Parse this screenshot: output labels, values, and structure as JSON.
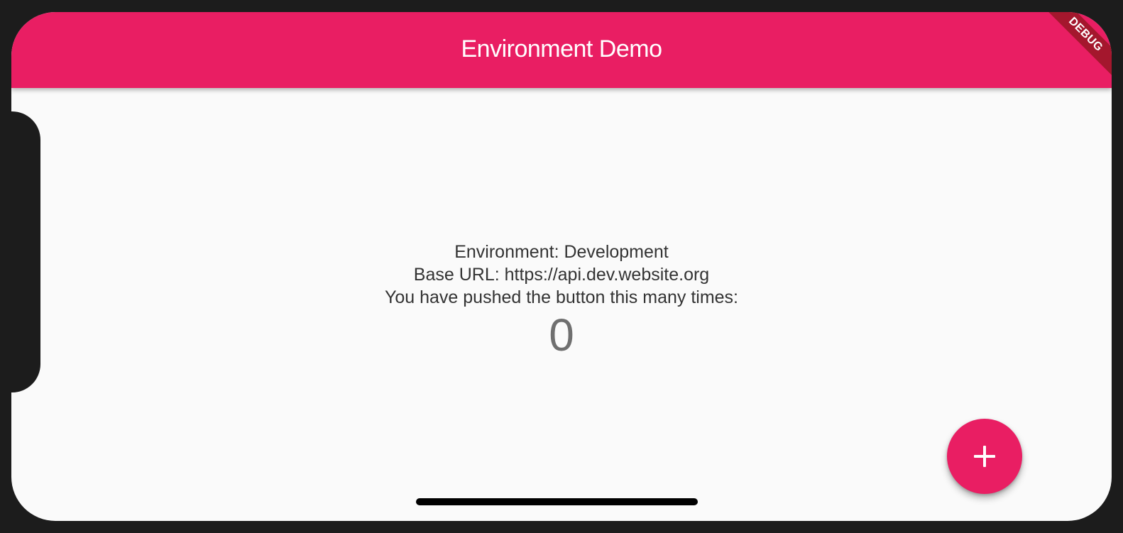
{
  "app_bar": {
    "title": "Environment Demo",
    "debug_label": "DEBUG",
    "color": "#e91e63"
  },
  "main": {
    "environment_text": "Environment: Development",
    "base_url_text": "Base URL: https://api.dev.website.org",
    "pushed_text": "You have pushed the button this many times:",
    "counter": "0"
  },
  "fab": {
    "icon": "plus-icon",
    "color": "#e91e63"
  }
}
